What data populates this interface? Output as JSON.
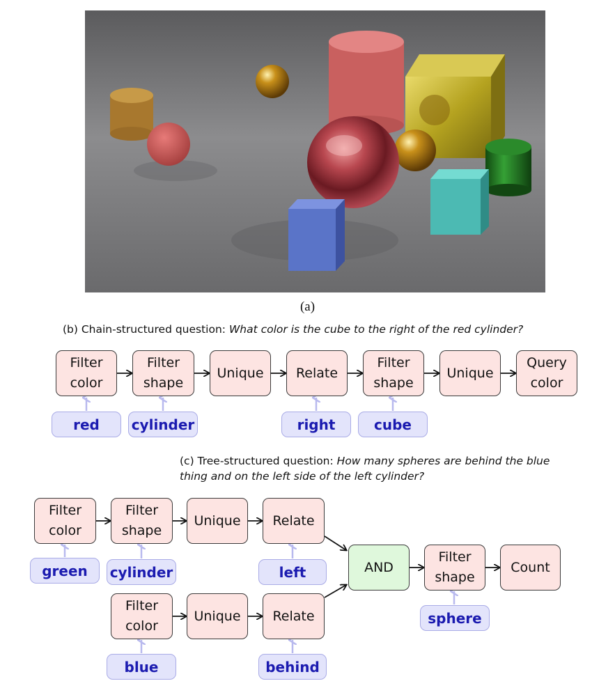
{
  "panels": {
    "a_label": "(a)",
    "b_prefix": "(b) Chain-structured question:",
    "b_question": "What color is the cube to the right of the red cylinder?",
    "c_prefix": "(c) Tree-structured question:",
    "c_question_line1": "How many spheres are behind the blue",
    "c_question_line2": "thing and on the left side of the left cylinder?"
  },
  "chain": {
    "modules": [
      {
        "label": "Filter\ncolor"
      },
      {
        "label": "Filter\nshape"
      },
      {
        "label": "Unique"
      },
      {
        "label": "Relate"
      },
      {
        "label": "Filter\nshape"
      },
      {
        "label": "Unique"
      },
      {
        "label": "Query\ncolor"
      }
    ],
    "args": [
      "red",
      "cylinder",
      "right",
      "cube"
    ]
  },
  "tree": {
    "modules": [
      {
        "label": "Filter\ncolor"
      },
      {
        "label": "Filter\nshape"
      },
      {
        "label": "Unique"
      },
      {
        "label": "Relate"
      },
      {
        "label": "Filter\ncolor"
      },
      {
        "label": "Unique"
      },
      {
        "label": "Relate"
      },
      {
        "label": "AND"
      },
      {
        "label": "Filter\nshape"
      },
      {
        "label": "Count"
      }
    ],
    "args": [
      "green",
      "cylinder",
      "left",
      "blue",
      "behind",
      "sphere"
    ]
  },
  "colors": {
    "module_fill": "#fde4e2",
    "and_fill": "#dff8dc",
    "arg_fill": "#e3e4fb",
    "arg_text": "#1b1bb0"
  }
}
